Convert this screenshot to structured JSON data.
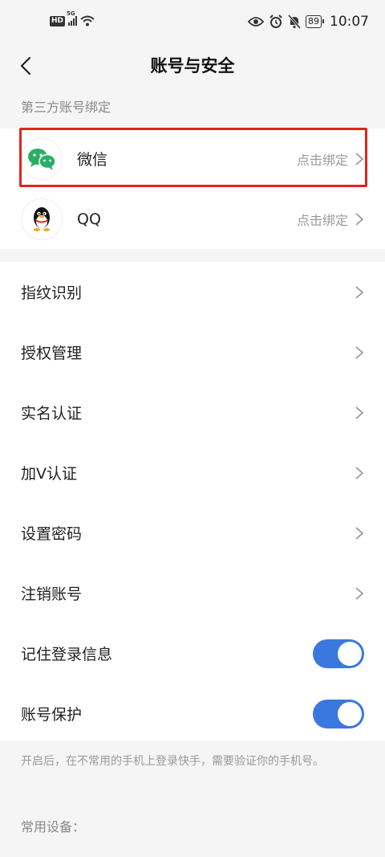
{
  "status_bar": {
    "hd_label": "HD",
    "network_label": "5G",
    "battery": "89",
    "time": "10:07"
  },
  "nav": {
    "title": "账号与安全"
  },
  "third_party": {
    "heading": "第三方账号绑定",
    "items": [
      {
        "name": "微信",
        "action": "点击绑定"
      },
      {
        "name": "QQ",
        "action": "点击绑定"
      }
    ]
  },
  "settings": {
    "items": [
      {
        "label": "指纹识别"
      },
      {
        "label": "授权管理"
      },
      {
        "label": "实名认证"
      },
      {
        "label": "加V认证"
      },
      {
        "label": "设置密码"
      },
      {
        "label": "注销账号"
      }
    ],
    "toggles": [
      {
        "label": "记住登录信息",
        "on": true
      },
      {
        "label": "账号保护",
        "on": true
      }
    ],
    "note": "开启后，在不常用的手机上登录快手，需要验证你的手机号。",
    "common_devices_heading": "常用设备："
  },
  "colors": {
    "toggle_on": "#3a78e0",
    "highlight": "#e1251b",
    "wechat_green": "#2aae67"
  }
}
